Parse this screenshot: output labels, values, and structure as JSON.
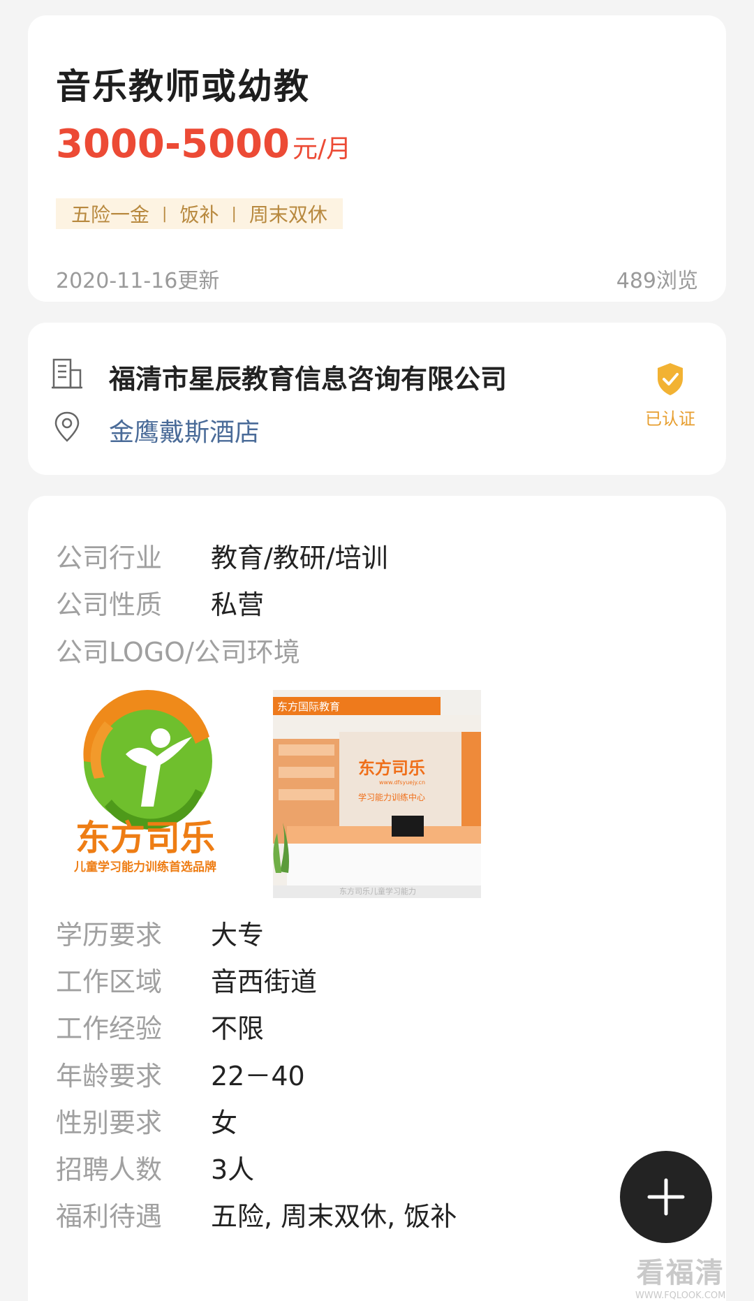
{
  "job": {
    "title": "音乐教师或幼教",
    "salary_range": "3000-5000",
    "salary_unit": "元/月",
    "perks": [
      "五险一金",
      "饭补",
      "周末双休"
    ],
    "perk_separator": "|",
    "updated": "2020-11-16更新",
    "views": "489浏览"
  },
  "company": {
    "name": "福清市星辰教育信息咨询有限公司",
    "address": "金鹰戴斯酒店",
    "verified_label": "已认证",
    "building_icon": "building-icon",
    "location_icon": "location-pin-icon",
    "verified_icon": "shield-check-icon"
  },
  "details": {
    "industry": {
      "label": "公司行业",
      "value": "教育/教研/培训"
    },
    "nature": {
      "label": "公司性质",
      "value": "私营"
    },
    "media_label": "公司LOGO/公司环境",
    "logo": {
      "brand_name": "东方司乐",
      "slogan": "儿童学习能力训练首选品牌"
    },
    "environment_photo": {
      "banner_text": "东方国际教育",
      "wall_brand": "东方司乐",
      "wall_url": "www.dfsyuejy.cn",
      "wall_subtitle": "学习能力训练中心",
      "photo_watermark": "东方司乐儿童学习能力"
    },
    "education": {
      "label": "学历要求",
      "value": "大专"
    },
    "area": {
      "label": "工作区域",
      "value": "音西街道"
    },
    "experience": {
      "label": "工作经验",
      "value": "不限"
    },
    "age": {
      "label": "年龄要求",
      "value": "22－40"
    },
    "gender": {
      "label": "性别要求",
      "value": "女"
    },
    "headcount": {
      "label": "招聘人数",
      "value": "3人"
    },
    "benefits": {
      "label": "福利待遇",
      "value": "五险, 周末双休, 饭补"
    }
  },
  "fab": {
    "icon": "plus-icon"
  },
  "watermark": {
    "main": "看福清",
    "sub": "WWW.FQLOOK.COM"
  },
  "colors": {
    "accent_red": "#ec4a35",
    "perk_gold": "#b8893f",
    "verified_orange": "#e79e2f",
    "link_blue": "#4a6b98"
  }
}
